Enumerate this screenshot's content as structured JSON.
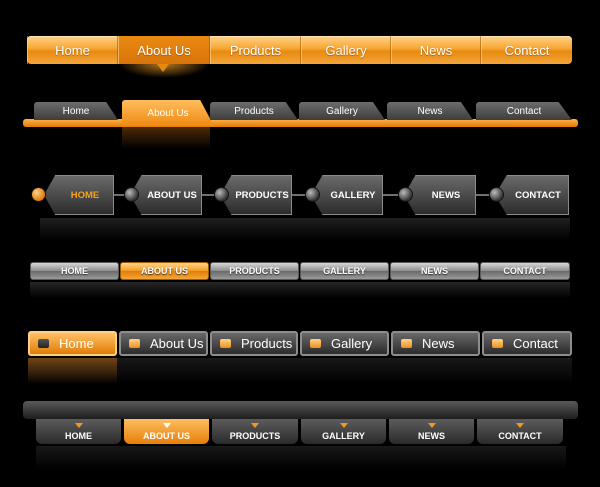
{
  "bar1": {
    "items": [
      "Home",
      "About Us",
      "Products",
      "Gallery",
      "News",
      "Contact"
    ],
    "active": "About Us"
  },
  "bar2": {
    "items": [
      "Home",
      "About Us",
      "Products",
      "Gallery",
      "News",
      "Contact"
    ],
    "active": "About Us"
  },
  "bar3": {
    "items": [
      "HOME",
      "ABOUT US",
      "PRODUCTS",
      "GALLERY",
      "NEWS",
      "CONTACT"
    ],
    "active": "HOME"
  },
  "bar4": {
    "items": [
      "HOME",
      "ABOUT US",
      "PRODUCTS",
      "GALLERY",
      "NEWS",
      "CONTACT"
    ],
    "active": "ABOUT US"
  },
  "bar5": {
    "items": [
      "Home",
      "About Us",
      "Products",
      "Gallery",
      "News",
      "Contact"
    ],
    "active": "Home"
  },
  "bar6": {
    "items": [
      "HOME",
      "ABOUT US",
      "PRODUCTS",
      "GALLERY",
      "NEWS",
      "CONTACT"
    ],
    "active": "ABOUT US"
  },
  "colors": {
    "accent": "#f39a1e",
    "background": "#000000",
    "inactive": "#3d3d3d"
  }
}
